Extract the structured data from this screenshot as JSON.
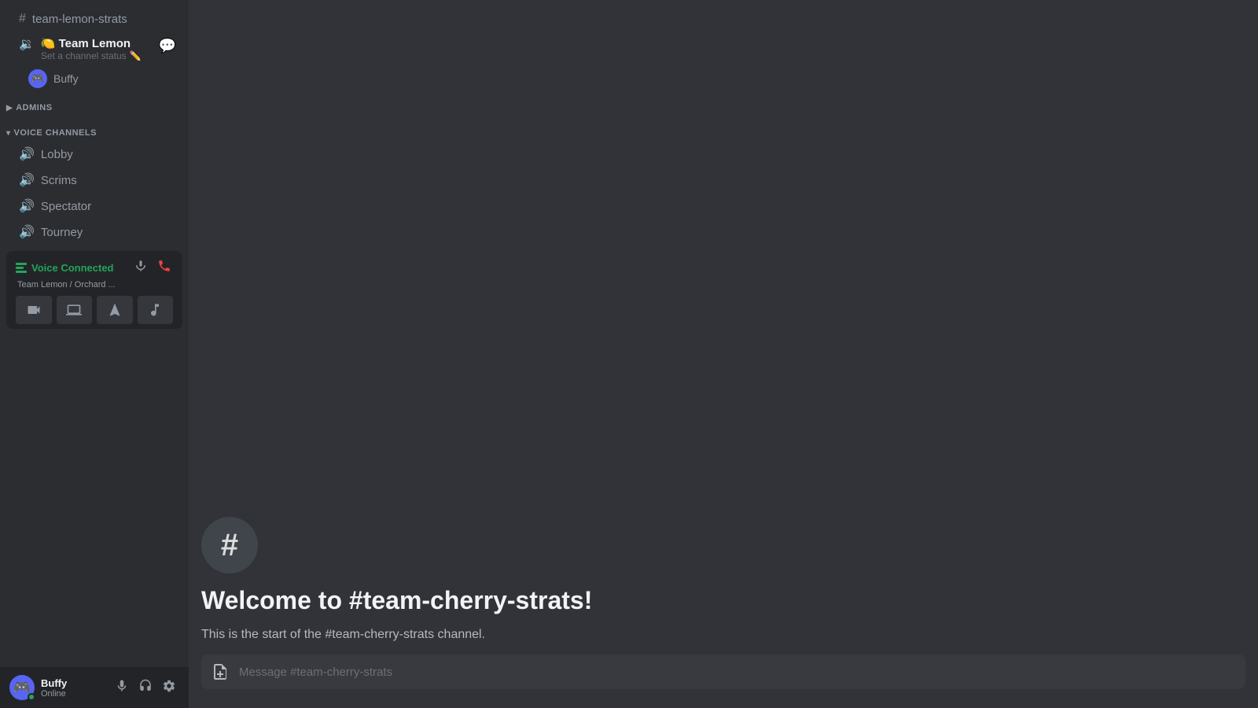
{
  "sidebar": {
    "channels": {
      "text": [
        {
          "name": "team-lemon-strats",
          "type": "text"
        }
      ]
    },
    "voice_server": {
      "name": "Team Lemon",
      "emoji": "🍋",
      "status": "Set a channel status",
      "status_icon": "✏️",
      "chat_icon": "💬",
      "member": {
        "name": "Buffy",
        "avatar_icon": "🎮"
      }
    },
    "sections": {
      "admins": {
        "label": "ADMINS",
        "collapsed": true
      },
      "voice_channels": {
        "label": "VOICE CHANNELS",
        "collapsed": false,
        "channels": [
          {
            "name": "Lobby"
          },
          {
            "name": "Scrims"
          },
          {
            "name": "Spectator"
          },
          {
            "name": "Tourney"
          }
        ]
      }
    },
    "voice_connected": {
      "status": "Voice Connected",
      "location": "Team Lemon / Orchard ...",
      "mute_icon": "🎙️",
      "disconnect_icon": "📞"
    },
    "voice_action_buttons": [
      {
        "name": "camera-button",
        "icon": "📷"
      },
      {
        "name": "screen-share-button",
        "icon": "🖥️"
      },
      {
        "name": "activity-button",
        "icon": "🚀"
      },
      {
        "name": "soundboard-button",
        "icon": "🎵"
      }
    ],
    "user": {
      "name": "Buffy",
      "status": "Online",
      "avatar_icon": "🎮"
    }
  },
  "main": {
    "welcome": {
      "title": "Welcome to #team-cherry-strats!",
      "description": "This is the start of the #team-cherry-strats channel."
    },
    "message_placeholder": "Message #team-cherry-strats"
  }
}
